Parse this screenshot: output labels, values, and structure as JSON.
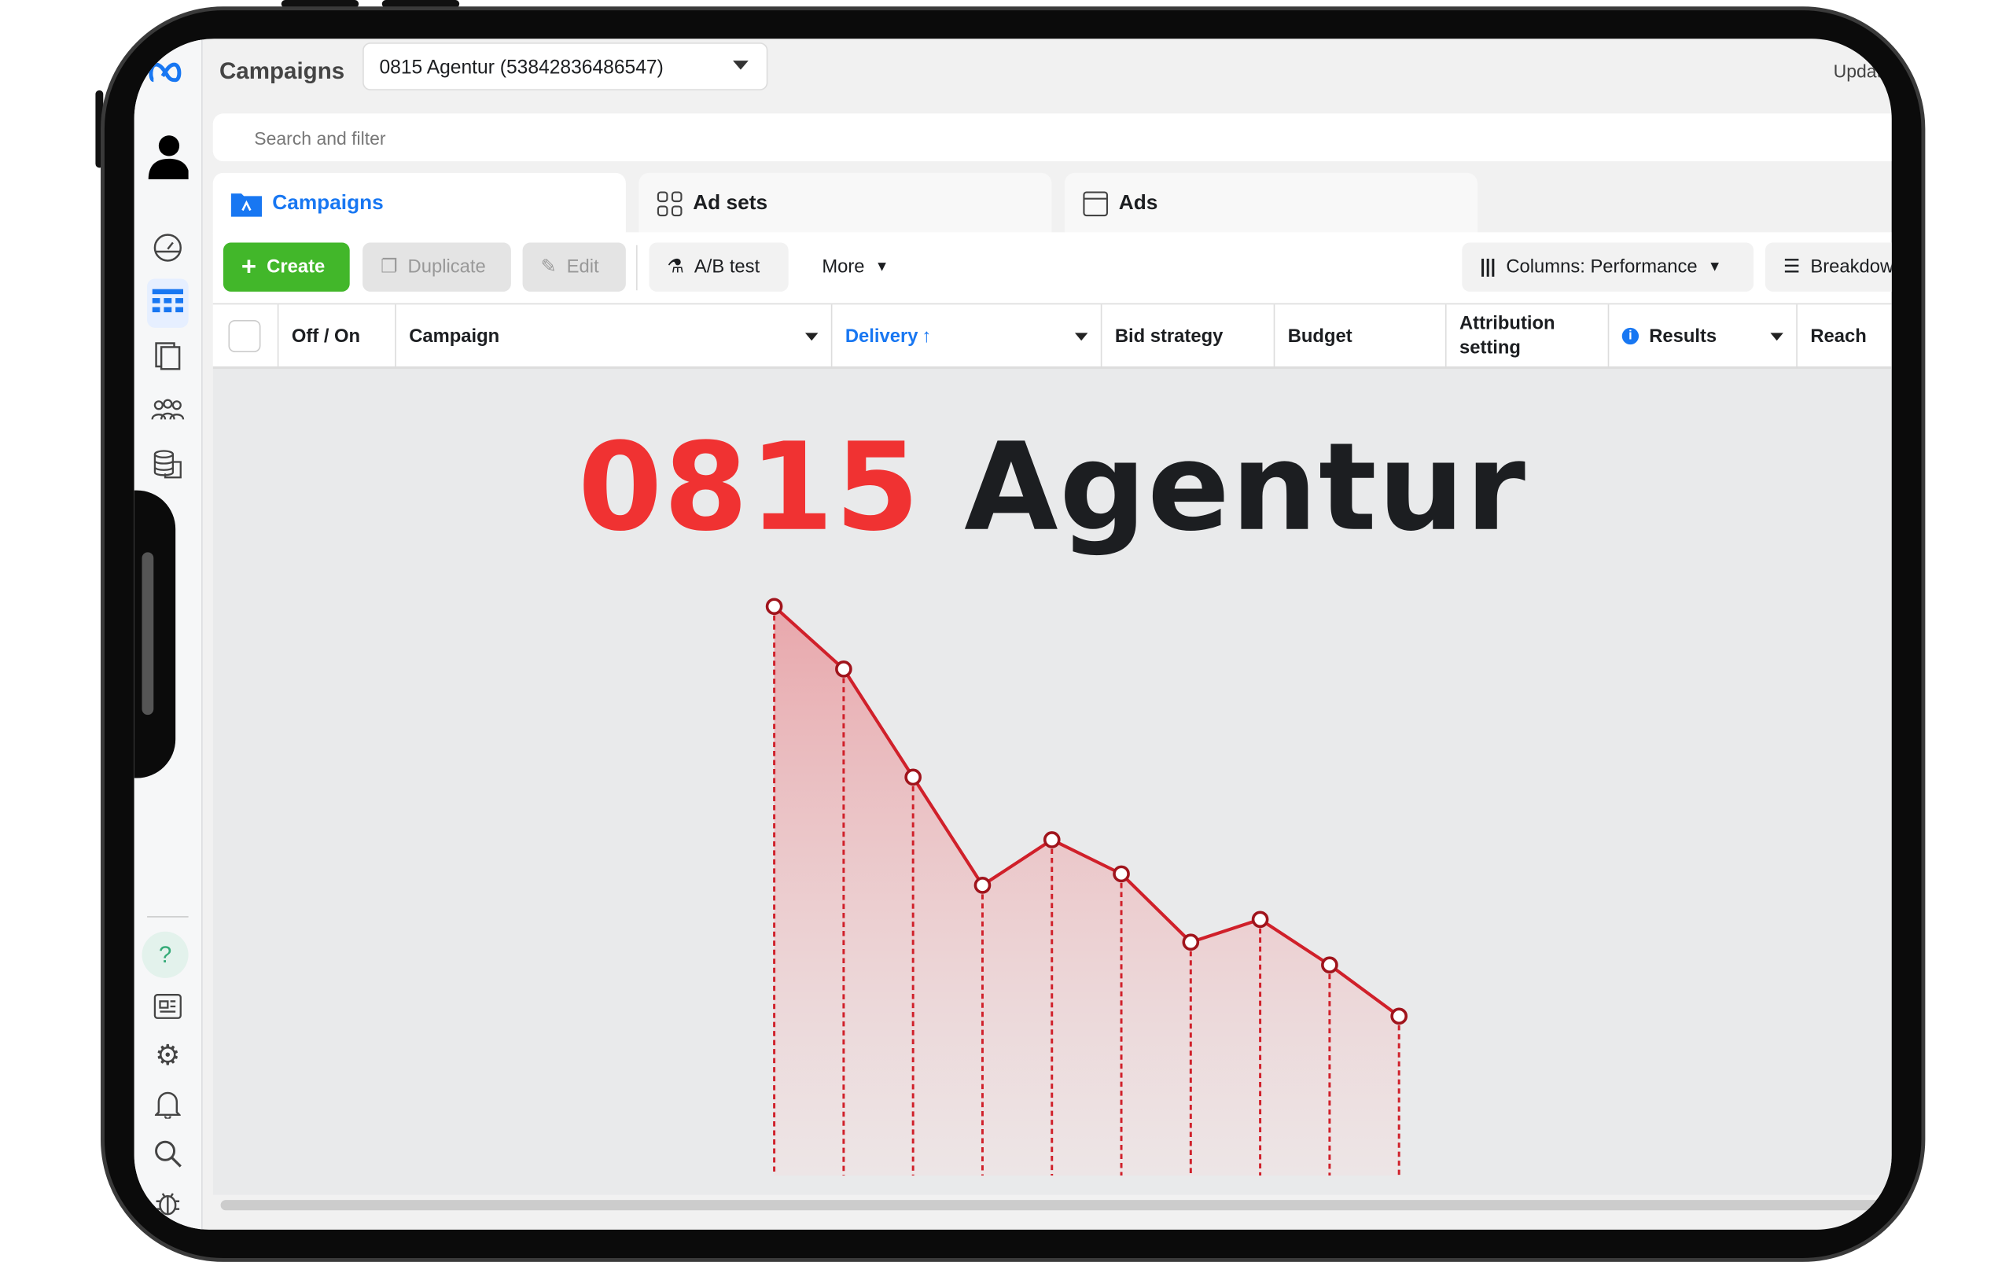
{
  "header": {
    "title": "Campaigns",
    "account": "0815 Agentur (53842836486547)",
    "update_label": "Update"
  },
  "search": {
    "placeholder": "Search and filter"
  },
  "tabs": [
    {
      "label": "Campaigns",
      "active": true
    },
    {
      "label": "Ad sets"
    },
    {
      "label": "Ads"
    }
  ],
  "toolbar": {
    "create": "Create",
    "duplicate": "Duplicate",
    "edit": "Edit",
    "ab_test": "A/B test",
    "more": "More",
    "columns": "Columns: Performance",
    "breakdown": "Breakdown"
  },
  "table": {
    "columns": [
      "Off / On",
      "Campaign",
      "Delivery",
      "Bid strategy",
      "Budget",
      "Attribution setting",
      "Results",
      "Reach"
    ],
    "sorted_column": "Delivery"
  },
  "headline": {
    "number": "0815",
    "word": "Agentur"
  },
  "colors": {
    "accent": "#1877f2",
    "create": "#42b72a",
    "headline_red": "#f03232",
    "line": "#d0202a"
  },
  "chart_data": {
    "type": "area",
    "values": [
      100,
      89,
      70,
      51,
      59,
      53,
      41,
      45,
      37,
      28
    ],
    "title": "",
    "xlabel": "",
    "ylabel": "",
    "grid": false
  }
}
